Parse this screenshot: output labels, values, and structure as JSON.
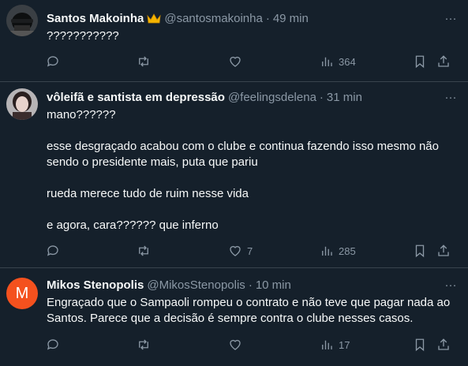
{
  "tweets": [
    {
      "name": "Santos Makoinha",
      "handle": "@santosmakoinha",
      "time": "49 min",
      "text": "???????????",
      "reply_count": "",
      "retweet_count": "",
      "like_count": "",
      "view_count": "364"
    },
    {
      "name": "vôleifã e santista em depressão",
      "handle": "@feelingsdelena",
      "time": "31 min",
      "text": "mano??????\n\nesse desgraçado acabou com o clube e continua fazendo isso mesmo não\nsendo o presidente mais, puta que pariu\n\nrueda merece tudo de ruim nesse vida\n\ne agora, cara?????? que inferno",
      "reply_count": "",
      "retweet_count": "",
      "like_count": "7",
      "view_count": "285"
    },
    {
      "name": "Mikos Stenopolis",
      "handle": "@MikosStenopolis",
      "time": "10 min",
      "avatar_letter": "M",
      "text": "Engraçado que o Sampaoli rompeu o contrato e não teve que pagar nada ao\nSantos. Parece que a decisão é sempre contra o clube nesses casos.",
      "reply_count": "",
      "retweet_count": "",
      "like_count": "",
      "view_count": "17"
    }
  ],
  "separator": "·",
  "more_glyph": "···",
  "colors": {
    "background": "#15202b",
    "secondary_text": "#8b98a5",
    "divider": "#38444d",
    "avatar_m": "#f4511e"
  }
}
